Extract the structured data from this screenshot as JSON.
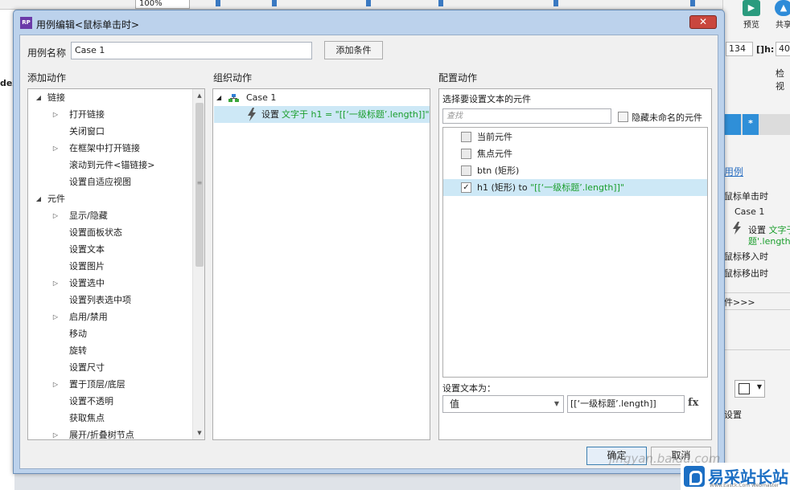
{
  "app": {
    "zoom": "100%",
    "toolbar": {
      "preview_label": "预览",
      "share_label": "共享"
    },
    "dimensions": {
      "w": "134",
      "h_label": "h:",
      "h": "40"
    },
    "inspector_label": "检视",
    "left_edge_text": "dex",
    "right_panel": {
      "tab_star": "*",
      "case_link": "用例",
      "events": [
        "鼠标单击时",
        "鼠标移入时",
        "鼠标移出时"
      ],
      "case_name": "Case 1",
      "action_line1_verb": "设置",
      "action_line1_detail": "文字于",
      "action_line2": "题'.length]]",
      "more_link": "件>>>",
      "settings_label": "设置"
    }
  },
  "dialog": {
    "title": "用例编辑<鼠标单击时>",
    "icon_text": "RP",
    "case_name_label": "用例名称",
    "case_name_value": "Case 1",
    "add_condition_button": "添加条件",
    "columns": {
      "add_action": "添加动作",
      "organize_action": "组织动作",
      "configure_action": "配置动作"
    },
    "action_tree": [
      {
        "label": "链接",
        "level": 0,
        "expand": "open"
      },
      {
        "label": "打开链接",
        "level": 1,
        "expand": "closed"
      },
      {
        "label": "关闭窗口",
        "level": 1,
        "expand": "none"
      },
      {
        "label": "在框架中打开链接",
        "level": 1,
        "expand": "closed"
      },
      {
        "label": "滚动到元件<锚链接>",
        "level": 1,
        "expand": "none"
      },
      {
        "label": "设置自适应视图",
        "level": 1,
        "expand": "none"
      },
      {
        "label": "元件",
        "level": 0,
        "expand": "open"
      },
      {
        "label": "显示/隐藏",
        "level": 1,
        "expand": "closed"
      },
      {
        "label": "设置面板状态",
        "level": 1,
        "expand": "none"
      },
      {
        "label": "设置文本",
        "level": 1,
        "expand": "none"
      },
      {
        "label": "设置图片",
        "level": 1,
        "expand": "none"
      },
      {
        "label": "设置选中",
        "level": 1,
        "expand": "closed"
      },
      {
        "label": "设置列表选中项",
        "level": 1,
        "expand": "none"
      },
      {
        "label": "启用/禁用",
        "level": 1,
        "expand": "closed"
      },
      {
        "label": "移动",
        "level": 1,
        "expand": "none"
      },
      {
        "label": "旋转",
        "level": 1,
        "expand": "none"
      },
      {
        "label": "设置尺寸",
        "level": 1,
        "expand": "none"
      },
      {
        "label": "置于顶层/底层",
        "level": 1,
        "expand": "closed"
      },
      {
        "label": "设置不透明",
        "level": 1,
        "expand": "none"
      },
      {
        "label": "获取焦点",
        "level": 1,
        "expand": "none"
      },
      {
        "label": "展开/折叠树节点",
        "level": 1,
        "expand": "closed"
      }
    ],
    "organize": {
      "case_label": "Case 1",
      "action_verb": "设置",
      "action_detail": "文字于 h1 = \"[[‘一级标题’.length]]\""
    },
    "configure": {
      "select_widget_label": "选择要设置文本的元件",
      "search_placeholder": "查找",
      "hide_unnamed_label": "隐藏未命名的元件",
      "widgets": [
        {
          "label": "当前元件",
          "checked": false,
          "extra": ""
        },
        {
          "label": "焦点元件",
          "checked": false,
          "extra": ""
        },
        {
          "label": "btn (矩形)",
          "checked": false,
          "extra": ""
        },
        {
          "label": "h1 (矩形) to ",
          "checked": true,
          "extra": "\"[[‘一级标题’.length]]\""
        }
      ],
      "set_text_label": "设置文本为：",
      "value_type": "值",
      "value_text": "[[‘一级标题’.length]]",
      "fx_label": "fx"
    },
    "ok_button": "确定",
    "cancel_button": "取消"
  },
  "watermark": {
    "text": "jingyan.baidu.com",
    "brand": "易采站长站",
    "brand_sub": "Www.Easck.Com  Webmaster"
  }
}
